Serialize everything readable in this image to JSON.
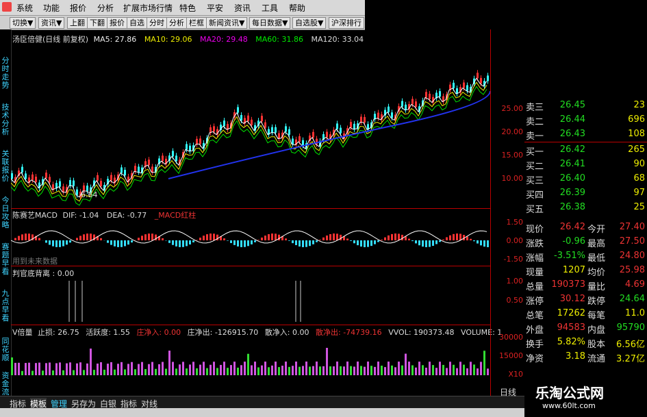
{
  "menu": [
    "系统",
    "功能",
    "报价",
    "分析",
    "扩展市场行情",
    "特色",
    "平安",
    "资讯",
    "工具",
    "帮助"
  ],
  "toolbar": [
    "切换▼",
    "资讯▼",
    "上翻",
    "下翻",
    "报价",
    "自选",
    "分时",
    "分析",
    "栏框",
    "新闻资讯▼",
    "每日数据▼",
    "自选股▼",
    "沪深排行"
  ],
  "side_tabs": [
    "分时走势",
    "技术分析",
    "关联报价",
    "今日攻略",
    "赛题早看",
    "九点早看",
    "同花顺",
    "资金流"
  ],
  "main_header": {
    "title": "汤臣倍健(日线 前复权)",
    "ma5": "MA5: 27.86",
    "ma10": "MA10: 29.06",
    "ma20": "MA20: 29.48",
    "ma60": "MA60: 31.86",
    "ma120": "MA120: 33.04"
  },
  "price_axis": [
    "25.00",
    "20.00",
    "15.00",
    "10.00"
  ],
  "low_label": "6.64",
  "macd_header": {
    "name": "陈赛艺MACD",
    "dif": "DIF: -1.04",
    "dea": "DEA: -0.77",
    "extra": "_MACD红柱"
  },
  "macd_axis": [
    "1.50",
    "0.00",
    "-1.50"
  ],
  "future_note": "用到未来数据",
  "bottom_header": {
    "text": "判官底背离 : 0.00"
  },
  "bottom_axis": [
    "1.00",
    "0.50"
  ],
  "vol_header": {
    "v1": "V倍量",
    "v2": "止损: 26.75",
    "v3": "活跃度: 1.55",
    "v4": "庄净入: 0.00",
    "v5": "庄净出: -126915.70",
    "v6": "散净入: 0.00",
    "v7": "散净出: -74739.16",
    "v8": "VVOL: 190373.48",
    "v9": "VOLUME: 1"
  },
  "vol_axis": [
    "30000",
    "15000",
    "X10"
  ],
  "x_axis": [
    "2010年",
    "3",
    "4",
    "5",
    "6",
    "7",
    "8",
    "9",
    "10",
    "11",
    "12",
    "1",
    "2",
    "3",
    "4",
    "5",
    "6",
    "7",
    "8",
    "9",
    "10",
    "11",
    "12",
    "1",
    "2",
    "3",
    "4",
    "5",
    "6"
  ],
  "quote": [
    {
      "label": "卖三",
      "price": "26.45",
      "vol": "23"
    },
    {
      "label": "卖二",
      "price": "26.44",
      "vol": "696"
    },
    {
      "label": "卖一",
      "price": "26.43",
      "vol": "108"
    },
    {
      "label": "买一",
      "price": "26.42",
      "vol": "265"
    },
    {
      "label": "买二",
      "price": "26.41",
      "vol": "90"
    },
    {
      "label": "买三",
      "price": "26.40",
      "vol": "68"
    },
    {
      "label": "买四",
      "price": "26.39",
      "vol": "97"
    },
    {
      "label": "买五",
      "price": "26.38",
      "vol": "25"
    }
  ],
  "stats": [
    {
      "l1": "现价",
      "v1": "26.42",
      "l2": "今开",
      "v2": "27.40"
    },
    {
      "l1": "涨跌",
      "v1": "-0.96",
      "l2": "最高",
      "v2": "27.50"
    },
    {
      "l1": "涨幅",
      "v1": "-3.51%",
      "l2": "最低",
      "v2": "24.80"
    },
    {
      "l1": "现量",
      "v1": "1207",
      "l2": "均价",
      "v2": "25.98"
    },
    {
      "l1": "总量",
      "v1": "190373",
      "l2": "量比",
      "v2": "4.69"
    },
    {
      "l1": "涨停",
      "v1": "30.12",
      "l2": "跌停",
      "v2": "24.64"
    },
    {
      "l1": "总笔",
      "v1": "17262",
      "l2": "每笔",
      "v2": "11.0"
    },
    {
      "l1": "外盘",
      "v1": "94583",
      "l2": "内盘",
      "v2": "95790"
    },
    {
      "l1": "换手",
      "v1": "5.82%",
      "l2": "股本",
      "v2": "6.56亿"
    },
    {
      "l1": "净资",
      "v1": "3.18",
      "l2": "流通",
      "v2": "3.27亿"
    }
  ],
  "bottom_tabs": [
    "指标",
    "模板",
    "管理",
    "另存为",
    "白银",
    "指标",
    "对线"
  ],
  "right_bottom_label": "日线",
  "logo": {
    "title": "乐淘公式网",
    "url": "www.60lt.com"
  }
}
